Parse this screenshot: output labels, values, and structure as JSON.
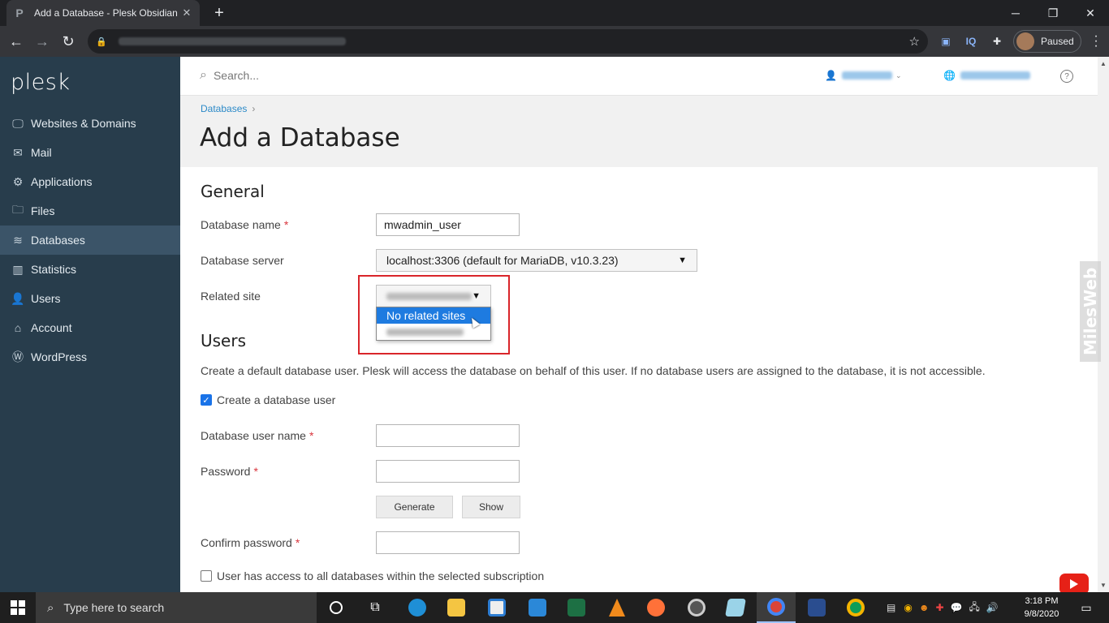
{
  "browser": {
    "tab_title": "Add a Database - Plesk Obsidian",
    "favicon_letter": "P",
    "profile_label": "Paused",
    "extension_iq": "IQ"
  },
  "sidebar": {
    "logo": "plesk",
    "items": [
      {
        "label": "Websites & Domains",
        "icon": "monitor-icon",
        "glyph": "🖵"
      },
      {
        "label": "Mail",
        "icon": "mail-icon",
        "glyph": "✉"
      },
      {
        "label": "Applications",
        "icon": "gear-icon",
        "glyph": "⚙"
      },
      {
        "label": "Files",
        "icon": "folder-icon",
        "glyph": "🗀"
      },
      {
        "label": "Databases",
        "icon": "database-icon",
        "glyph": "≋"
      },
      {
        "label": "Statistics",
        "icon": "bar-chart-icon",
        "glyph": "▥"
      },
      {
        "label": "Users",
        "icon": "user-icon",
        "glyph": "👤"
      },
      {
        "label": "Account",
        "icon": "id-card-icon",
        "glyph": "⌂"
      },
      {
        "label": "WordPress",
        "icon": "wordpress-icon",
        "glyph": "Ⓦ"
      }
    ],
    "active_index": 4
  },
  "header": {
    "search_placeholder": "Search..."
  },
  "page": {
    "breadcrumb": "Databases",
    "breadcrumb_sep": "›",
    "title": "Add a Database"
  },
  "general": {
    "heading": "General",
    "db_name_label": "Database name",
    "db_name_value": "mwadmin_user",
    "db_server_label": "Database server",
    "db_server_value": "localhost:3306 (default for MariaDB, v10.3.23)",
    "related_site_label": "Related site",
    "related_site_options": [
      "No related sites"
    ]
  },
  "users": {
    "heading": "Users",
    "description": "Create a default database user. Plesk will access the database on behalf of this user. If no database users are assigned to the database, it is not accessible.",
    "create_user_label": "Create a database user",
    "create_user_checked": true,
    "user_name_label": "Database user name",
    "password_label": "Password",
    "generate_label": "Generate",
    "show_label": "Show",
    "confirm_password_label": "Confirm password",
    "access_all_label": "User has access to all databases within the selected subscription",
    "access_all_checked": false
  },
  "required_mark": "*",
  "watermark": "MilesWeb",
  "taskbar": {
    "search_placeholder": "Type here to search",
    "time": "3:18 PM",
    "date": "9/8/2020"
  },
  "colors": {
    "sidebar_bg": "#283d4c",
    "sidebar_active": "#3b5468",
    "link": "#2c8ac8",
    "dropdown_selected": "#1e7be0",
    "highlight": "#d9252a"
  }
}
